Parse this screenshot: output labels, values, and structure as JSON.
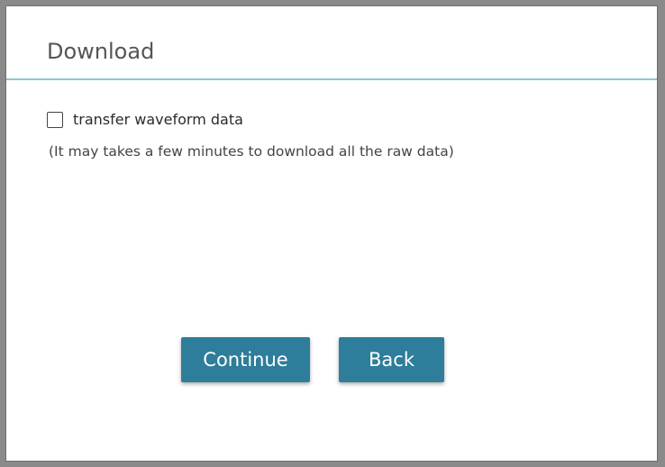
{
  "dialog": {
    "title": "Download",
    "option": {
      "label": "transfer waveform data",
      "checked": false
    },
    "hint": "(It may takes a few minutes to download all the raw data)",
    "buttons": {
      "continue_label": "Continue",
      "back_label": "Back"
    }
  },
  "colors": {
    "accent": "#2e7d9b",
    "header_rule": "#8fc6d3"
  }
}
